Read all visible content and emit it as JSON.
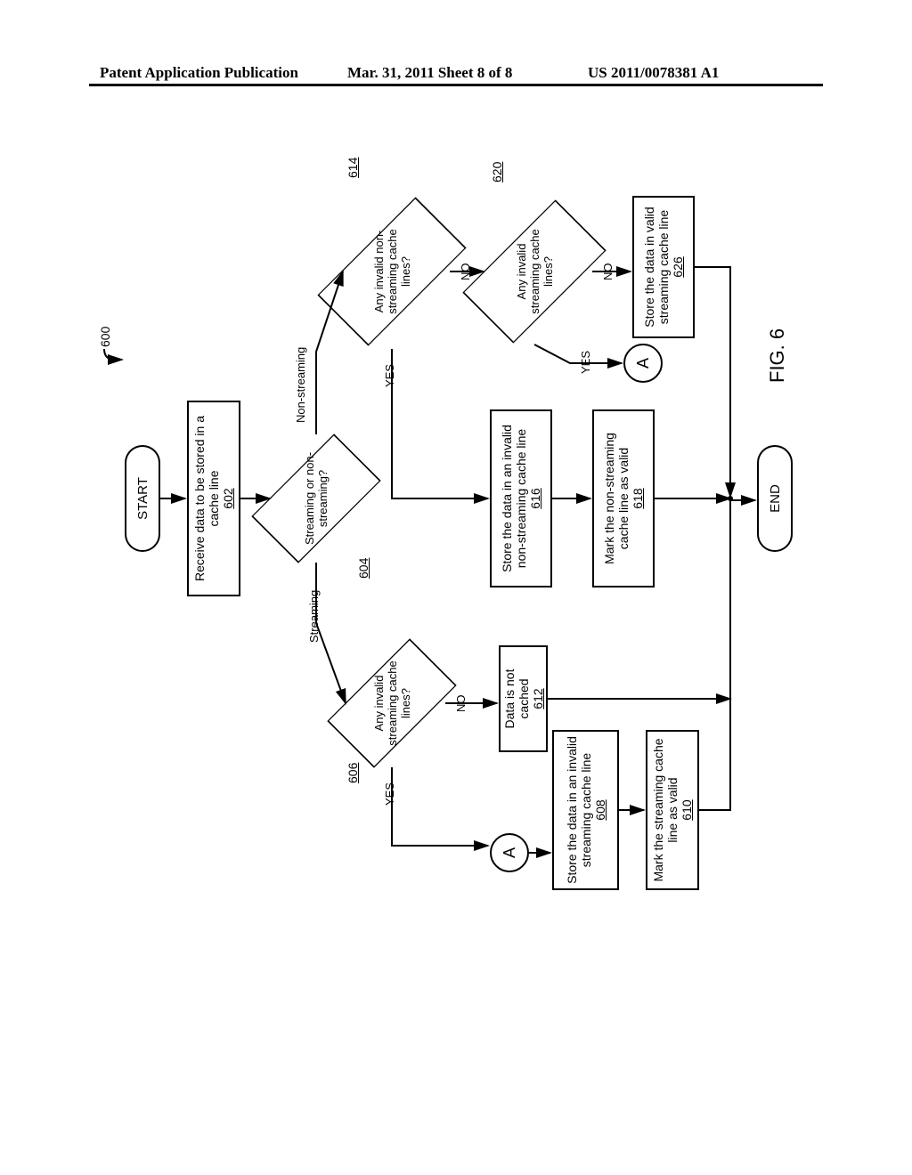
{
  "header": {
    "left": "Patent Application Publication",
    "mid": "Mar. 31, 2011  Sheet 8 of 8",
    "right": "US 2011/0078381 A1"
  },
  "fig": {
    "label": "FIG. 6",
    "number_callout": "600"
  },
  "terminals": {
    "start": "START",
    "end": "END"
  },
  "connectors": {
    "a": "A"
  },
  "nodes": {
    "n602": {
      "text": "Receive data to be stored in a cache line",
      "ref": "602"
    },
    "n604": {
      "text": "Streaming or non-streaming?",
      "ref": "604",
      "out_left": "Streaming",
      "out_right": "Non-streaming"
    },
    "n606": {
      "text": "Any invalid streaming cache lines?",
      "ref": "606",
      "out_yes": "YES",
      "out_no": "NO"
    },
    "n608": {
      "text": "Store the data in an invalid streaming cache line",
      "ref": "608"
    },
    "n610": {
      "text": "Mark the streaming cache line as valid",
      "ref": "610"
    },
    "n612": {
      "text": "Data is not cached",
      "ref": "612"
    },
    "n614": {
      "text": "Any invalid non-streaming cache lines?",
      "ref": "614",
      "out_yes": "YES",
      "out_no": "NO"
    },
    "n616": {
      "text": "Store the data in an invalid non-streaming cache line",
      "ref": "616"
    },
    "n618": {
      "text": "Mark the non-streaming cache line as valid",
      "ref": "618"
    },
    "n620": {
      "text": "Any invalid streaming cache lines?",
      "ref": "620",
      "out_yes": "YES",
      "out_no": "NO"
    },
    "n626": {
      "text": "Store the data in valid streaming cache line",
      "ref": "626"
    }
  }
}
